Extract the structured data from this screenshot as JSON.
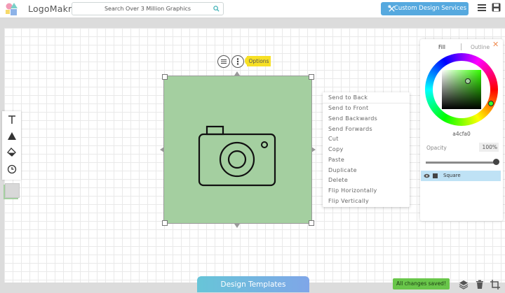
{
  "app": {
    "name": "LogoMakr",
    "search_placeholder": "Search Over 3 Million Graphics",
    "custom_design_label": "Custom Design Services",
    "accent": "#56a9df"
  },
  "selection": {
    "options_label": "Options",
    "shape_color": "#a4cfa0",
    "icon": "camera-icon"
  },
  "context_menu": {
    "items": [
      "Send to Back",
      "Send to Front",
      "Send Backwards",
      "Send Forwards",
      "Cut",
      "Copy",
      "Paste",
      "Duplicate",
      "Delete",
      "Flip Horizontally",
      "Flip Vertically"
    ]
  },
  "color_panel": {
    "tab_fill": "Fill",
    "tab_outline": "Outline",
    "hex_value": "a4cfa0",
    "opacity_label": "Opacity",
    "opacity_value": "100%",
    "opacity_fraction": 1.0,
    "layer_name": "Square"
  },
  "footer": {
    "templates_label": "Design Templates",
    "status": "All changes saved!"
  }
}
